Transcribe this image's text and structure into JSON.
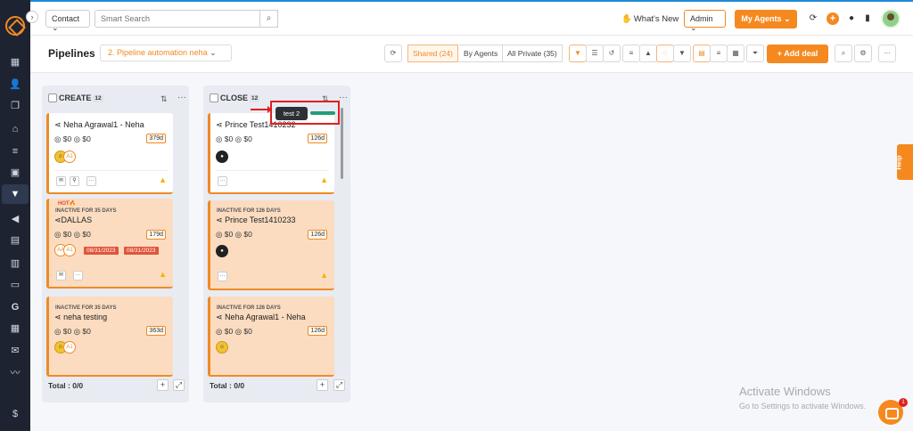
{
  "sidebar": {
    "icons": [
      "dashboard-icon",
      "contacts-icon",
      "documents-icon",
      "bank-icon",
      "list-icon",
      "profile-card-icon",
      "pipeline-filter-icon",
      "campaign-icon",
      "ledger-icon",
      "reports-icon",
      "folder-icon",
      "g-icon",
      "calendar-icon",
      "mail-icon",
      "signature-icon",
      "dollar-icon"
    ]
  },
  "topbar": {
    "contact_select": "Contact",
    "search_placeholder": "Smart Search",
    "whats_new": "What's New",
    "admin_select": "Admin",
    "my_agents": "My Agents"
  },
  "subbar": {
    "title": "Pipelines",
    "pipeline_select": "2. Pipeline automation neha",
    "shared": "Shared (24)",
    "by_agents": "By Agents",
    "all_private": "All Private (35)",
    "add_deal": "Add deal"
  },
  "columns": [
    {
      "title": "CREATE",
      "count": "12",
      "total": "Total : 0/0",
      "cards": [
        {
          "name": "Neha Agrawal1 - Neha",
          "amount1": "$0",
          "amount2": "$0",
          "days": "379d",
          "initials": "A1"
        },
        {
          "hot": "HOT",
          "inactive": "INACTIVE FOR 35 DAYS",
          "name": "DALLAS",
          "amount1": "$0",
          "amount2": "$0",
          "days": "179d",
          "initials1": "AA",
          "initials2": "A1",
          "date1": "08/31/2023",
          "date2": "08/31/2023"
        },
        {
          "inactive": "INACTIVE FOR 35 DAYS",
          "name": "neha testing",
          "amount1": "$0",
          "amount2": "$0",
          "days": "363d",
          "initials": "A1"
        }
      ]
    },
    {
      "title": "CLOSE",
      "count": "12",
      "total": "Total : 0/0",
      "cards": [
        {
          "name": "Prince Test1410232",
          "amount1": "$0",
          "amount2": "$0",
          "days": "126d"
        },
        {
          "inactive": "INACTIVE FOR 126 DAYS",
          "name": "Prince Test1410233",
          "amount1": "$0",
          "amount2": "$0",
          "days": "126d"
        },
        {
          "inactive": "INACTIVE FOR 126 DAYS",
          "name": "Neha Agrawal1 - Neha",
          "amount1": "$0",
          "amount2": "$0",
          "days": "126d"
        }
      ]
    }
  ],
  "tooltip": {
    "label": "test 2"
  },
  "help": "Help",
  "chat_badge": "1",
  "windows": {
    "title": "Activate Windows",
    "subtitle": "Go to Settings to activate Windows."
  },
  "colors": {
    "accent": "#f5891f",
    "sidebar": "#1d2330",
    "topline": "#1f8ad8",
    "alert": "#e02020"
  }
}
